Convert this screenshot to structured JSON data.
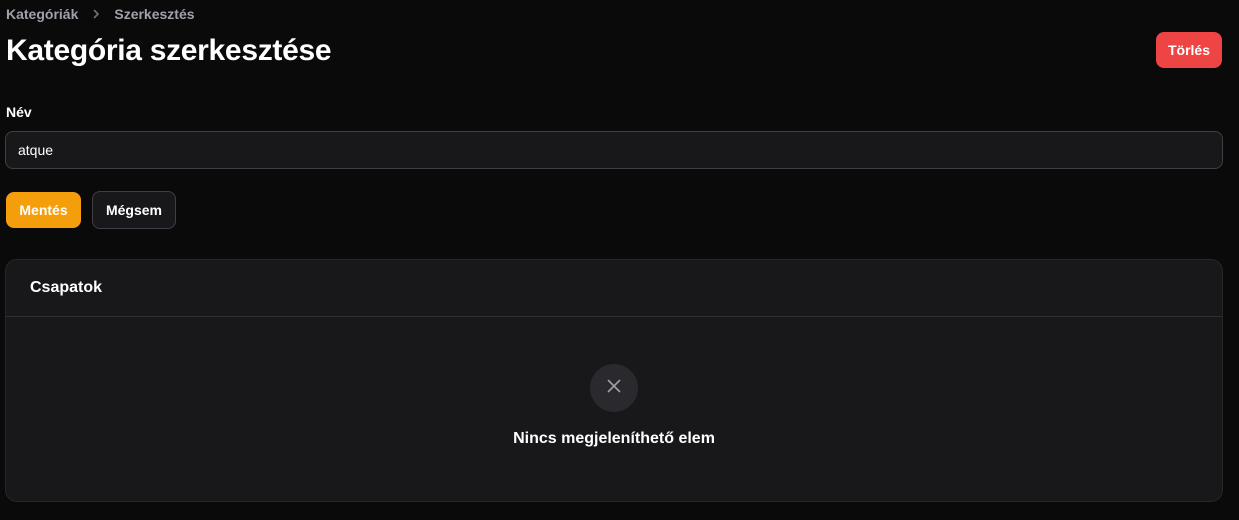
{
  "breadcrumb": {
    "items": [
      {
        "label": "Kategóriák"
      },
      {
        "label": "Szerkesztés"
      }
    ]
  },
  "header": {
    "title": "Kategória szerkesztése",
    "delete_label": "Törlés"
  },
  "form": {
    "name_label": "Név",
    "name_value": "atque",
    "save_label": "Mentés",
    "cancel_label": "Mégsem"
  },
  "teams_panel": {
    "title": "Csapatok",
    "empty_text": "Nincs megjeleníthető elem",
    "empty_icon": "x-icon"
  },
  "colors": {
    "background": "#0a0a0b",
    "primary": "#f59e0b",
    "danger": "#ef4444",
    "panel": "#18181b"
  }
}
